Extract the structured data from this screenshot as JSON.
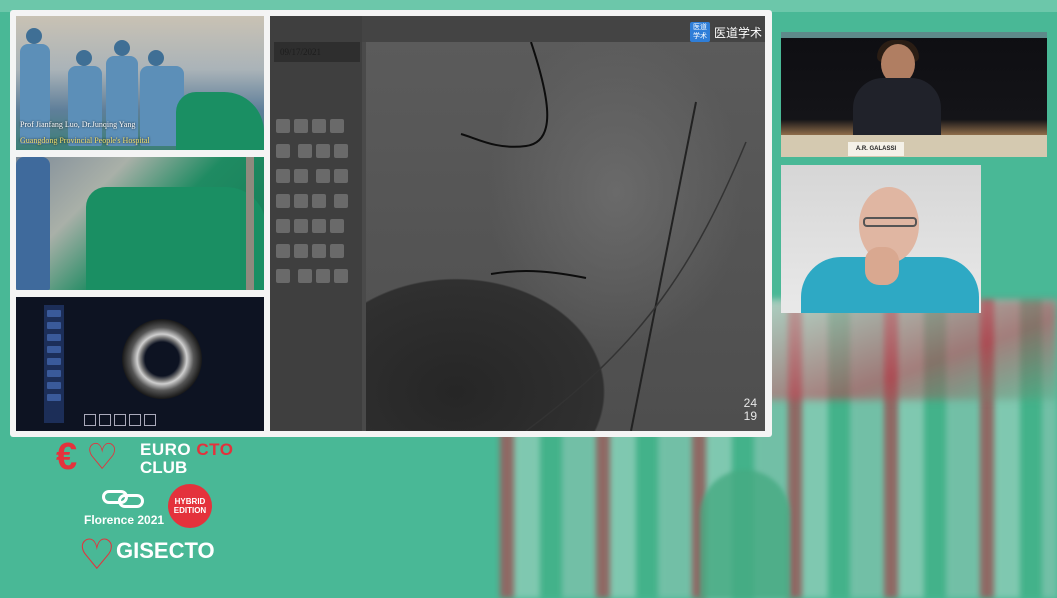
{
  "theme": {
    "background": "#49b896",
    "accent_red": "#e4323c",
    "white": "#ffffff"
  },
  "video_feeds": {
    "cathlab_caption": {
      "names": "Prof Jianfang Luo, Dr.Junqing Yang",
      "hospital": "Guangdong Provincial People's Hospital"
    },
    "fluoroscopy": {
      "date": "09/17/2021",
      "frame_counter_top": "24",
      "frame_counter_bottom": "19"
    },
    "watermark": {
      "badge": "医道 学术",
      "label": "医道学术"
    },
    "speaker_nameplate": "A.R. GALASSI"
  },
  "branding": {
    "euro_cto_line1_a": "EURO ",
    "euro_cto_line1_b": "CTO",
    "euro_cto_line2": "CLUB",
    "florence": "Florence 2021",
    "hybrid_badge": "HYBRID EDITION",
    "gise_a": "GISE",
    "gise_b": "CTO"
  },
  "icons": [
    "heart-logo-icon",
    "rings-logo-icon",
    "ivus-ring-icon"
  ]
}
